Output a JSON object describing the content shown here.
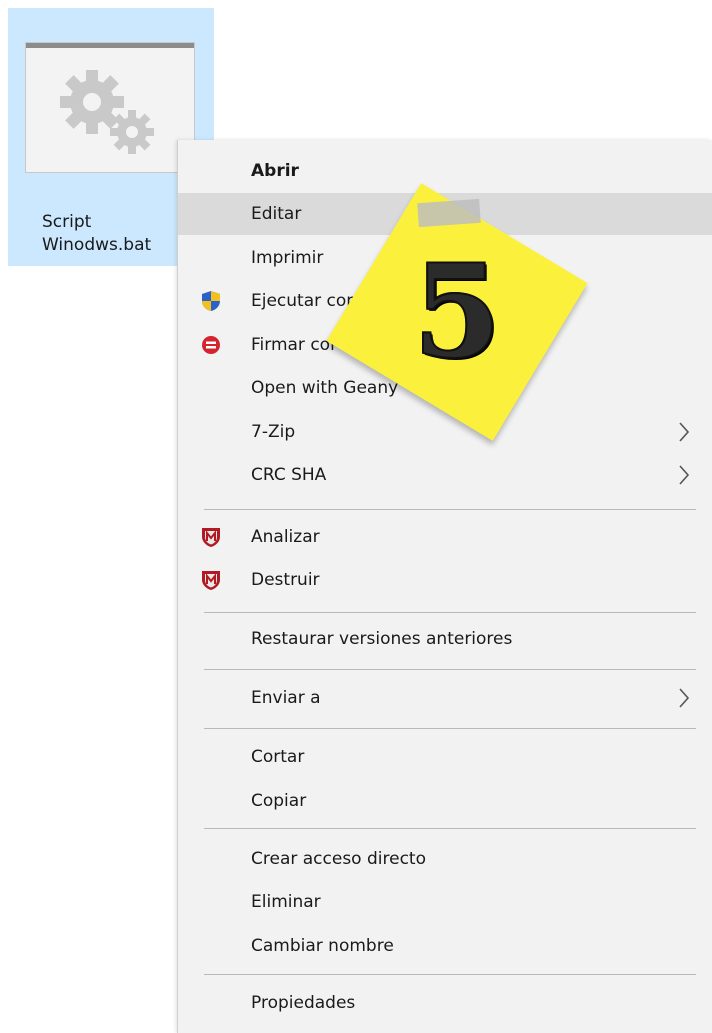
{
  "file": {
    "name_line1": "Script",
    "name_line2": "Winodws.bat",
    "icon": "gears-icon"
  },
  "menu": {
    "items": [
      {
        "label": "Abrir",
        "bold": true
      },
      {
        "label": "Editar",
        "highlighted": true
      },
      {
        "label": "Imprimir"
      },
      {
        "label": "Ejecutar com",
        "icon": "uac-shield-icon"
      },
      {
        "label": "Firmar cor",
        "icon": "sign-icon"
      },
      {
        "label": "Open with Geany"
      },
      {
        "label": "7-Zip",
        "submenu": true
      },
      {
        "label": "CRC SHA",
        "submenu": true
      },
      {
        "label": "Analizar",
        "icon": "mcafee-icon"
      },
      {
        "label": "Destruir",
        "icon": "mcafee-icon"
      },
      {
        "label": "Restaurar versiones anteriores"
      },
      {
        "label": "Enviar a",
        "submenu": true
      },
      {
        "label": "Cortar"
      },
      {
        "label": "Copiar"
      },
      {
        "label": "Crear acceso directo"
      },
      {
        "label": "Eliminar"
      },
      {
        "label": "Cambiar nombre"
      },
      {
        "label": "Propiedades"
      }
    ]
  },
  "annotation": {
    "number": "5",
    "color": "#fbf13c"
  }
}
